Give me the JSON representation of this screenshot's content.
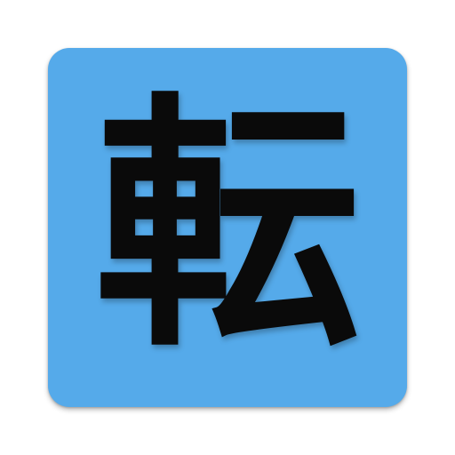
{
  "app_icon": {
    "glyph": "転",
    "background_color": "#55aaea",
    "glyph_color": "#0a0a0a"
  }
}
